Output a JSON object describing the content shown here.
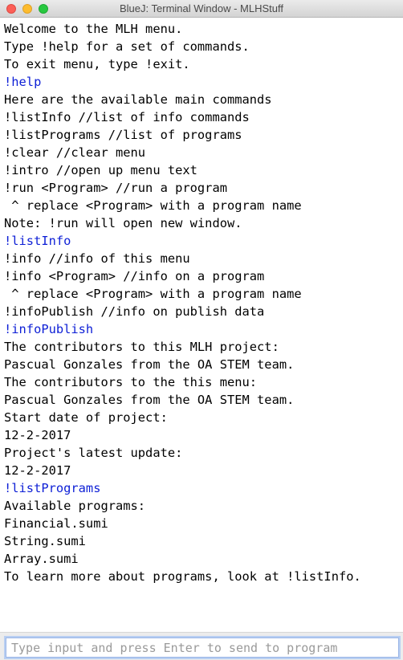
{
  "window": {
    "title": "BlueJ: Terminal Window - MLHStuff"
  },
  "terminal": {
    "lines": [
      {
        "text": "Welcome to the MLH menu.",
        "kind": "output"
      },
      {
        "text": "Type !help for a set of commands.",
        "kind": "output"
      },
      {
        "text": "To exit menu, type !exit.",
        "kind": "output"
      },
      {
        "text": "!help",
        "kind": "input"
      },
      {
        "text": "Here are the available main commands",
        "kind": "output"
      },
      {
        "text": "!listInfo //list of info commands",
        "kind": "output"
      },
      {
        "text": "!listPrograms //list of programs",
        "kind": "output"
      },
      {
        "text": "!clear //clear menu",
        "kind": "output"
      },
      {
        "text": "!intro //open up menu text",
        "kind": "output"
      },
      {
        "text": "!run <Program> //run a program",
        "kind": "output"
      },
      {
        "text": " ^ replace <Program> with a program name",
        "kind": "output"
      },
      {
        "text": "Note: !run will open new window.",
        "kind": "output"
      },
      {
        "text": "!listInfo",
        "kind": "input"
      },
      {
        "text": "!info //info of this menu",
        "kind": "output"
      },
      {
        "text": "!info <Program> //info on a program",
        "kind": "output"
      },
      {
        "text": " ^ replace <Program> with a program name",
        "kind": "output"
      },
      {
        "text": "!infoPublish //info on publish data",
        "kind": "output"
      },
      {
        "text": "!infoPublish",
        "kind": "input"
      },
      {
        "text": "The contributors to this MLH project:",
        "kind": "output"
      },
      {
        "text": "Pascual Gonzales from the OA STEM team.",
        "kind": "output"
      },
      {
        "text": "The contributors to the this menu:",
        "kind": "output"
      },
      {
        "text": "Pascual Gonzales from the OA STEM team.",
        "kind": "output"
      },
      {
        "text": "Start date of project:",
        "kind": "output"
      },
      {
        "text": "12-2-2017",
        "kind": "output"
      },
      {
        "text": "Project's latest update:",
        "kind": "output"
      },
      {
        "text": "12-2-2017",
        "kind": "output"
      },
      {
        "text": "!listPrograms",
        "kind": "input"
      },
      {
        "text": "Available programs:",
        "kind": "output"
      },
      {
        "text": "Financial.sumi",
        "kind": "output"
      },
      {
        "text": "String.sumi",
        "kind": "output"
      },
      {
        "text": "Array.sumi",
        "kind": "output"
      },
      {
        "text": "To learn more about programs, look at !listInfo.",
        "kind": "output"
      }
    ]
  },
  "input": {
    "value": "",
    "placeholder": "Type input and press Enter to send to program"
  },
  "colors": {
    "command_text": "#0d1fd6",
    "output_text": "#000000",
    "terminal_background": "#ffffff"
  }
}
